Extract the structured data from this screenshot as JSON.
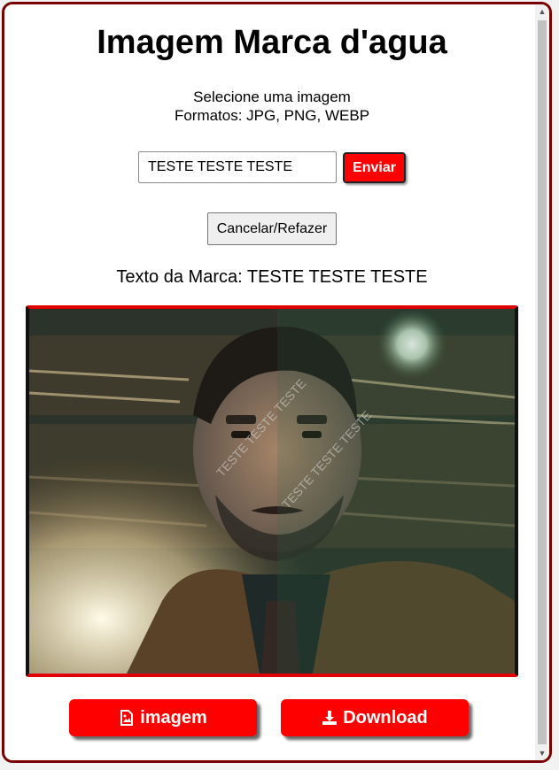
{
  "header": {
    "title": "Imagem Marca d'agua"
  },
  "instructions": {
    "line1": "Selecione uma imagem",
    "line2": "Formatos: JPG, PNG, WEBP"
  },
  "form": {
    "text_value": "TESTE TESTE TESTE",
    "send_label": "Enviar",
    "cancel_label": "Cancelar/Refazer"
  },
  "mark": {
    "label": "Texto da Marca: TESTE TESTE TESTE"
  },
  "preview": {
    "watermark_text": "TESTE TESTE TESTE"
  },
  "actions": {
    "image_label": "imagem",
    "image_icon": "image-file-icon",
    "download_label": "Download",
    "download_icon": "download-icon"
  },
  "colors": {
    "accent": "#ff0000",
    "frame": "#7a0000"
  }
}
